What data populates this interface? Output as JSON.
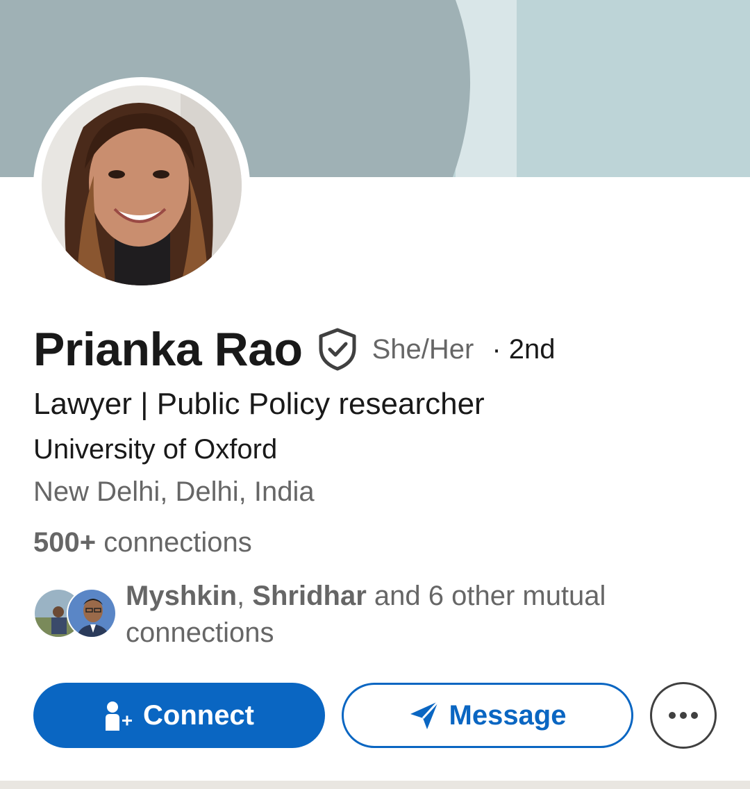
{
  "profile": {
    "name": "Prianka Rao",
    "pronouns": "She/Her",
    "degree": "· 2nd",
    "headline": "Lawyer | Public Policy researcher",
    "education": "University of Oxford",
    "location": "New Delhi, Delhi, India"
  },
  "connections": {
    "count": "500+",
    "label": "connections"
  },
  "mutual": {
    "person1": "Myshkin",
    "separator": ", ",
    "person2": "Shridhar",
    "rest": " and 6 other mutual connections"
  },
  "actions": {
    "connect_label": "Connect",
    "message_label": "Message"
  },
  "icons": {
    "verified": "shield-check-icon",
    "connect": "add-person-icon",
    "message": "send-icon",
    "more": "more-horizontal-icon"
  },
  "colors": {
    "primary_blue": "#0a66c2",
    "text_primary": "#191919",
    "text_secondary": "#666666",
    "banner_left": "#9fb1b5",
    "banner_right": "#bdd4d7"
  }
}
